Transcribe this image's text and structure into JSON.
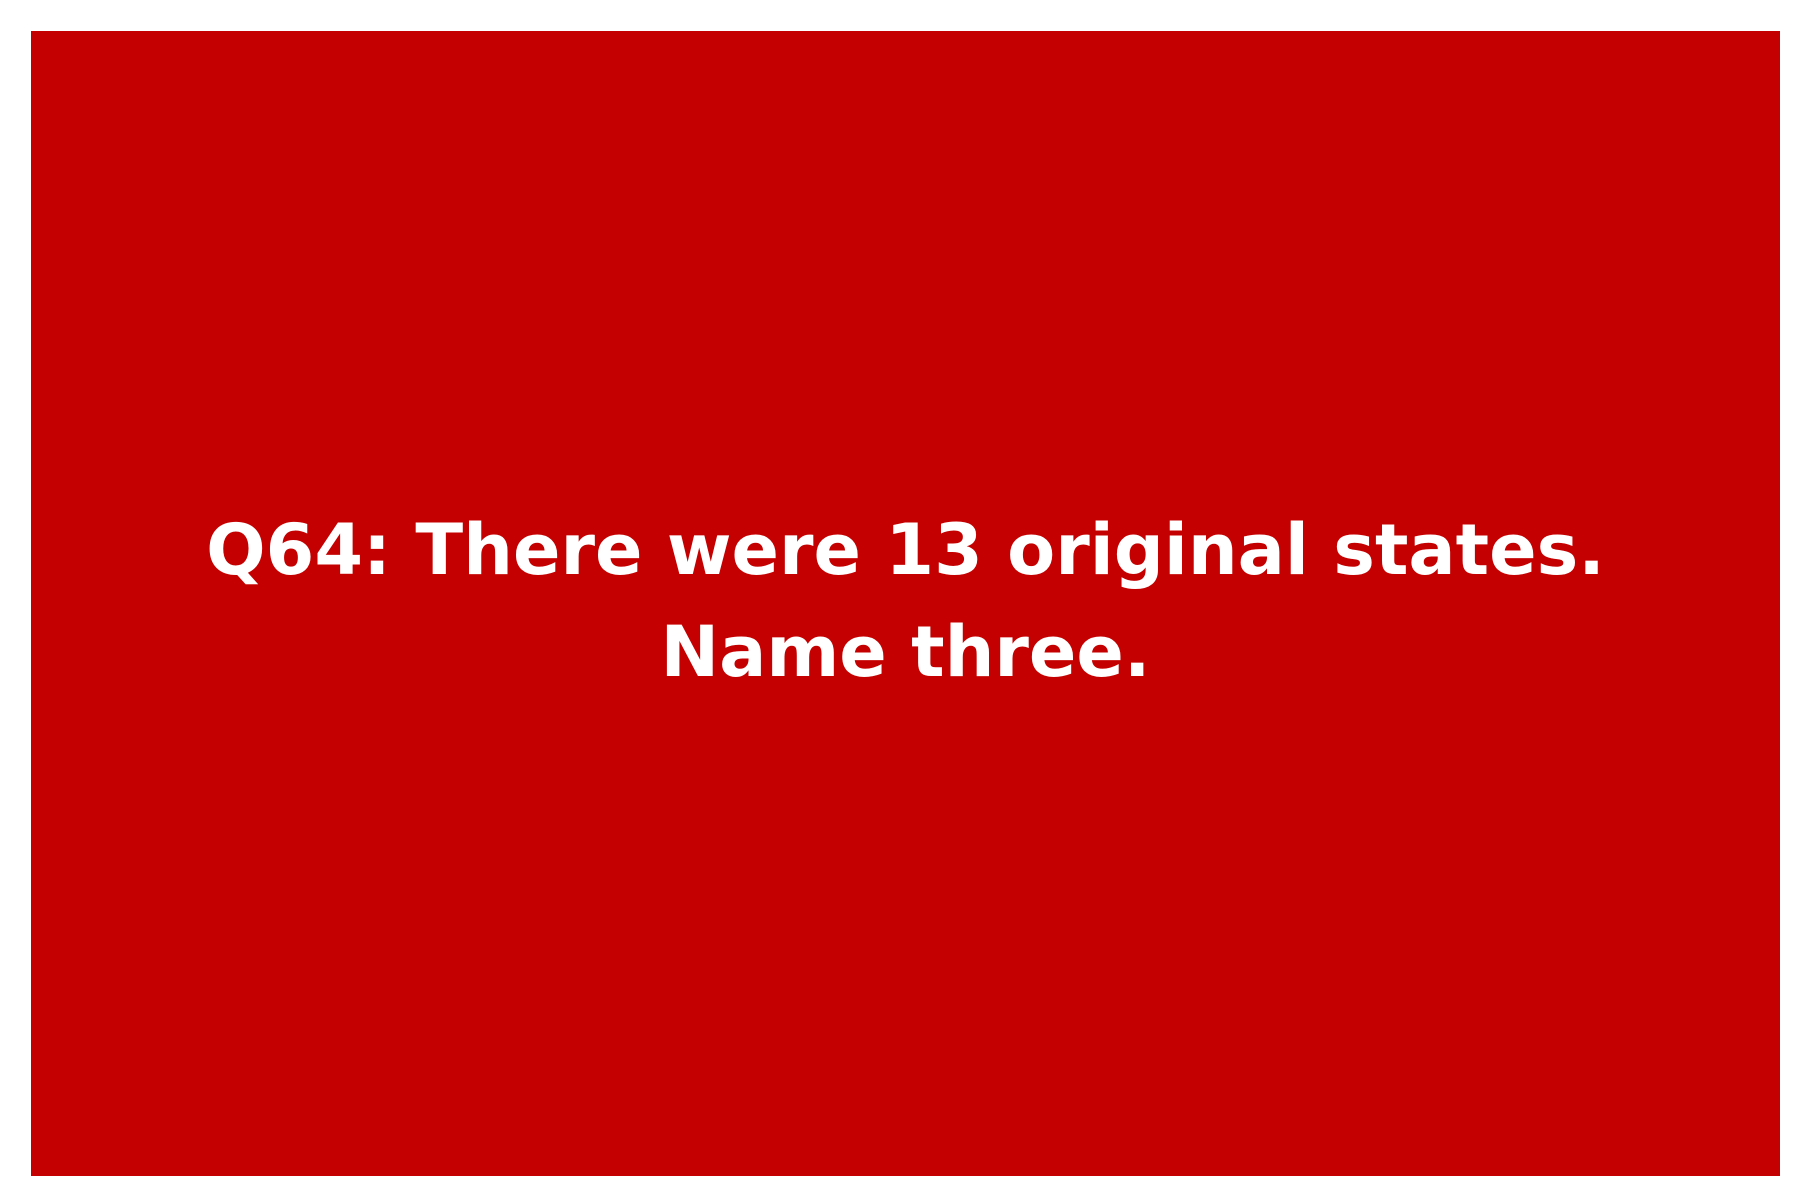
{
  "colors": {
    "page_background": "#ffffff",
    "card_background": "#c40000",
    "text": "#ffffff"
  },
  "question": {
    "line1": "Q64: There were 13 original states.",
    "line2": "Name three."
  }
}
